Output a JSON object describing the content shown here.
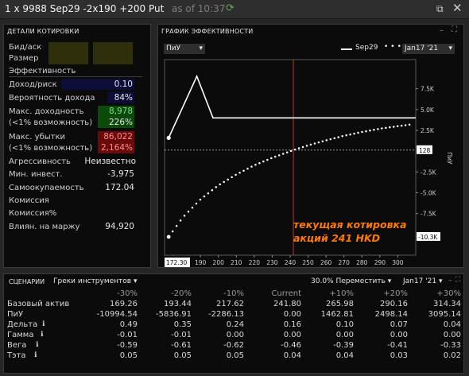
{
  "header": {
    "title": "1 x 9988 Sep29  -2x190  +200 Put",
    "as_of": "as of 10:37"
  },
  "quotes": {
    "title": "ДЕТАЛИ КОТИРОВКИ",
    "bid_ask_label": "Бид/аск",
    "size_label": "Размер",
    "efficiency_label": "Эффективность",
    "return_risk_label": "Доход/риск",
    "return_risk_value": "0.10",
    "prob_label": "Вероятность дохода",
    "prob_value": "84%",
    "max_return_label": "Макс. доходность",
    "max_return_value": "8,978",
    "max_return_sub_label": "(<1% возможность)",
    "max_return_pct": "226%",
    "max_loss_label": "Макс. убытки",
    "max_loss_value": "86,022",
    "max_loss_sub_label": "(<1% возможность)",
    "max_loss_pct": "2,164%",
    "aggr_label": "Агрессивность",
    "aggr_value": "Неизвестно",
    "min_inv_label": "Мин. инвест.",
    "min_inv_value": "-3,975",
    "payback_label": "Самоокупаемость",
    "payback_value": "172.04",
    "commission_label": "Комиссия",
    "commission_pct_label": "Комиссия%",
    "margin_label": "Влиян. на маржу",
    "margin_value": "94,920"
  },
  "chart": {
    "title": "ГРАФИК ЭФФЕКТИВНОСТИ",
    "pnl_select": "ПиУ",
    "legend_sep": "Sep29",
    "date_select": "Jan17 '21",
    "annotation_line1": "текущая котировка",
    "annotation_line2": "акций 241 HKD",
    "ylabel": "ПиУ",
    "current_value_label": "128",
    "low_value_label": "-10.3K",
    "left_x_label": "172.30",
    "colors": {
      "expiry": "#ffffff",
      "current": "#ffffff",
      "annotation": "#ff7a00",
      "price_line": "#c0392b"
    }
  },
  "chart_data": {
    "type": "line",
    "xlim": [
      170,
      310
    ],
    "ylim": [
      -12500,
      11000
    ],
    "xticks": [
      190,
      200,
      210,
      220,
      230,
      240,
      250,
      260,
      270,
      280,
      290,
      300
    ],
    "yticks": [
      {
        "v": 7500,
        "t": "7.5K"
      },
      {
        "v": 5000,
        "t": "5.0K"
      },
      {
        "v": 2500,
        "t": "2.5K"
      },
      {
        "v": -2500,
        "t": "-2.5K"
      },
      {
        "v": -5000,
        "t": "-5.0K"
      },
      {
        "v": -7500,
        "t": "-7.5K"
      }
    ],
    "current_price": 241.8,
    "series": [
      {
        "name": "Sep29",
        "style": "solid",
        "points": [
          [
            172.3,
            1600
          ],
          [
            188,
            9000
          ],
          [
            197,
            4000
          ],
          [
            310,
            4000
          ]
        ]
      },
      {
        "name": "Jan17 '21",
        "style": "dotted",
        "points": [
          [
            172.3,
            -10300
          ],
          [
            180,
            -8000
          ],
          [
            190,
            -5800
          ],
          [
            200,
            -4100
          ],
          [
            210,
            -2800
          ],
          [
            220,
            -1700
          ],
          [
            230,
            -800
          ],
          [
            241.8,
            128
          ],
          [
            250,
            700
          ],
          [
            260,
            1300
          ],
          [
            270,
            1850
          ],
          [
            280,
            2300
          ],
          [
            290,
            2700
          ],
          [
            300,
            3000
          ],
          [
            307,
            3200
          ]
        ]
      }
    ]
  },
  "scenarios": {
    "title": "СЦЕНАРИИ",
    "greeks_select": "Греки инструментов",
    "move_select": "30.0% Переместить",
    "date_select": "Jan17 '21",
    "columns": [
      "-30%",
      "-20%",
      "-10%",
      "Current",
      "+10%",
      "+20%",
      "+30%"
    ],
    "rows": [
      {
        "label": "Базовый актив",
        "values": [
          "169.26",
          "193.44",
          "217.62",
          "241.80",
          "265.98",
          "290.16",
          "314.34"
        ]
      },
      {
        "label": "ПиУ",
        "values": [
          "-10994.54",
          "-5836.91",
          "-2286.13",
          "0.00",
          "1462.81",
          "2498.14",
          "3095.14"
        ]
      },
      {
        "label": "Дельта",
        "values": [
          "0.49",
          "0.35",
          "0.24",
          "0.16",
          "0.10",
          "0.07",
          "0.04"
        ]
      },
      {
        "label": "Гамма",
        "values": [
          "-0.01",
          "-0.01",
          "0.00",
          "0.00",
          "0.00",
          "0.00",
          "0.00"
        ]
      },
      {
        "label": "Вега",
        "values": [
          "-0.59",
          "-0.61",
          "-0.62",
          "-0.46",
          "-0.39",
          "-0.41",
          "-0.33"
        ]
      },
      {
        "label": "Тэта",
        "values": [
          "0.05",
          "0.05",
          "0.05",
          "0.04",
          "0.04",
          "0.03",
          "0.02"
        ]
      }
    ]
  }
}
